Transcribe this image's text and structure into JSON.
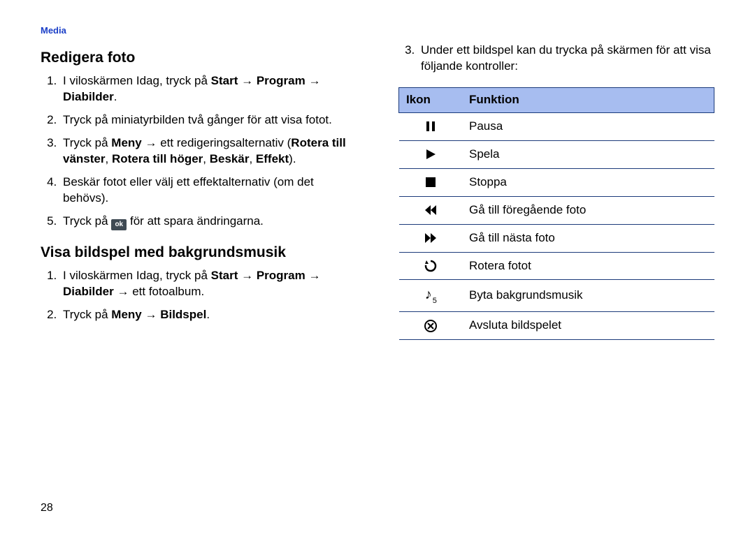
{
  "header": {
    "section_label": "Media"
  },
  "page_number": "28",
  "left": {
    "heading1": "Redigera foto",
    "steps1": {
      "s1_a": "I viloskärmen Idag, tryck på ",
      "s1_b_start": "Start",
      "s1_arrow": " → ",
      "s1_b_prog": "Program",
      "s1_b_dia": "Diabilder",
      "s1_period": ".",
      "s2": "Tryck på miniatyrbilden två gånger för att visa fotot.",
      "s3_a": "Tryck på ",
      "s3_b_meny": "Meny",
      "s3_arrow": " → ",
      "s3_b": "ett redigeringsalternativ (",
      "s3_opt1": "Rotera till vänster",
      "s3_comma": ", ",
      "s3_opt2": "Rotera till höger",
      "s3_opt3": "Beskär",
      "s3_opt4": "Effekt",
      "s3_close": ").",
      "s4": "Beskär fotot eller välj ett effektalternativ (om det behövs).",
      "s5_a": "Tryck på ",
      "s5_ok": "ok",
      "s5_b": " för att spara ändringarna."
    },
    "heading2": "Visa bildspel med bakgrundsmusik",
    "steps2": {
      "s1_a": "I viloskärmen Idag, tryck på ",
      "s1_start": "Start",
      "s1_arrow": " → ",
      "s1_prog": "Program",
      "s1_dia": "Diabilder",
      "s1_b": " → ett fotoalbum.",
      "s2_a": "Tryck på ",
      "s2_meny": "Meny",
      "s2_arrow": " → ",
      "s2_bild": "Bildspel",
      "s2_period": "."
    }
  },
  "right": {
    "step3": "Under ett bildspel kan du trycka på skärmen för att visa följande kontroller:",
    "table": {
      "head_icon": "Ikon",
      "head_func": "Funktion",
      "rows": [
        {
          "icon": "pause",
          "label": "Pausa"
        },
        {
          "icon": "play",
          "label": "Spela"
        },
        {
          "icon": "stop",
          "label": "Stoppa"
        },
        {
          "icon": "rewind",
          "label": "Gå till föregående foto"
        },
        {
          "icon": "ffwd",
          "label": "Gå till nästa foto"
        },
        {
          "icon": "rotate",
          "label": "Rotera fotot"
        },
        {
          "icon": "music",
          "label": "Byta bakgrundsmusik"
        },
        {
          "icon": "close",
          "label": "Avsluta bildspelet"
        }
      ]
    }
  }
}
